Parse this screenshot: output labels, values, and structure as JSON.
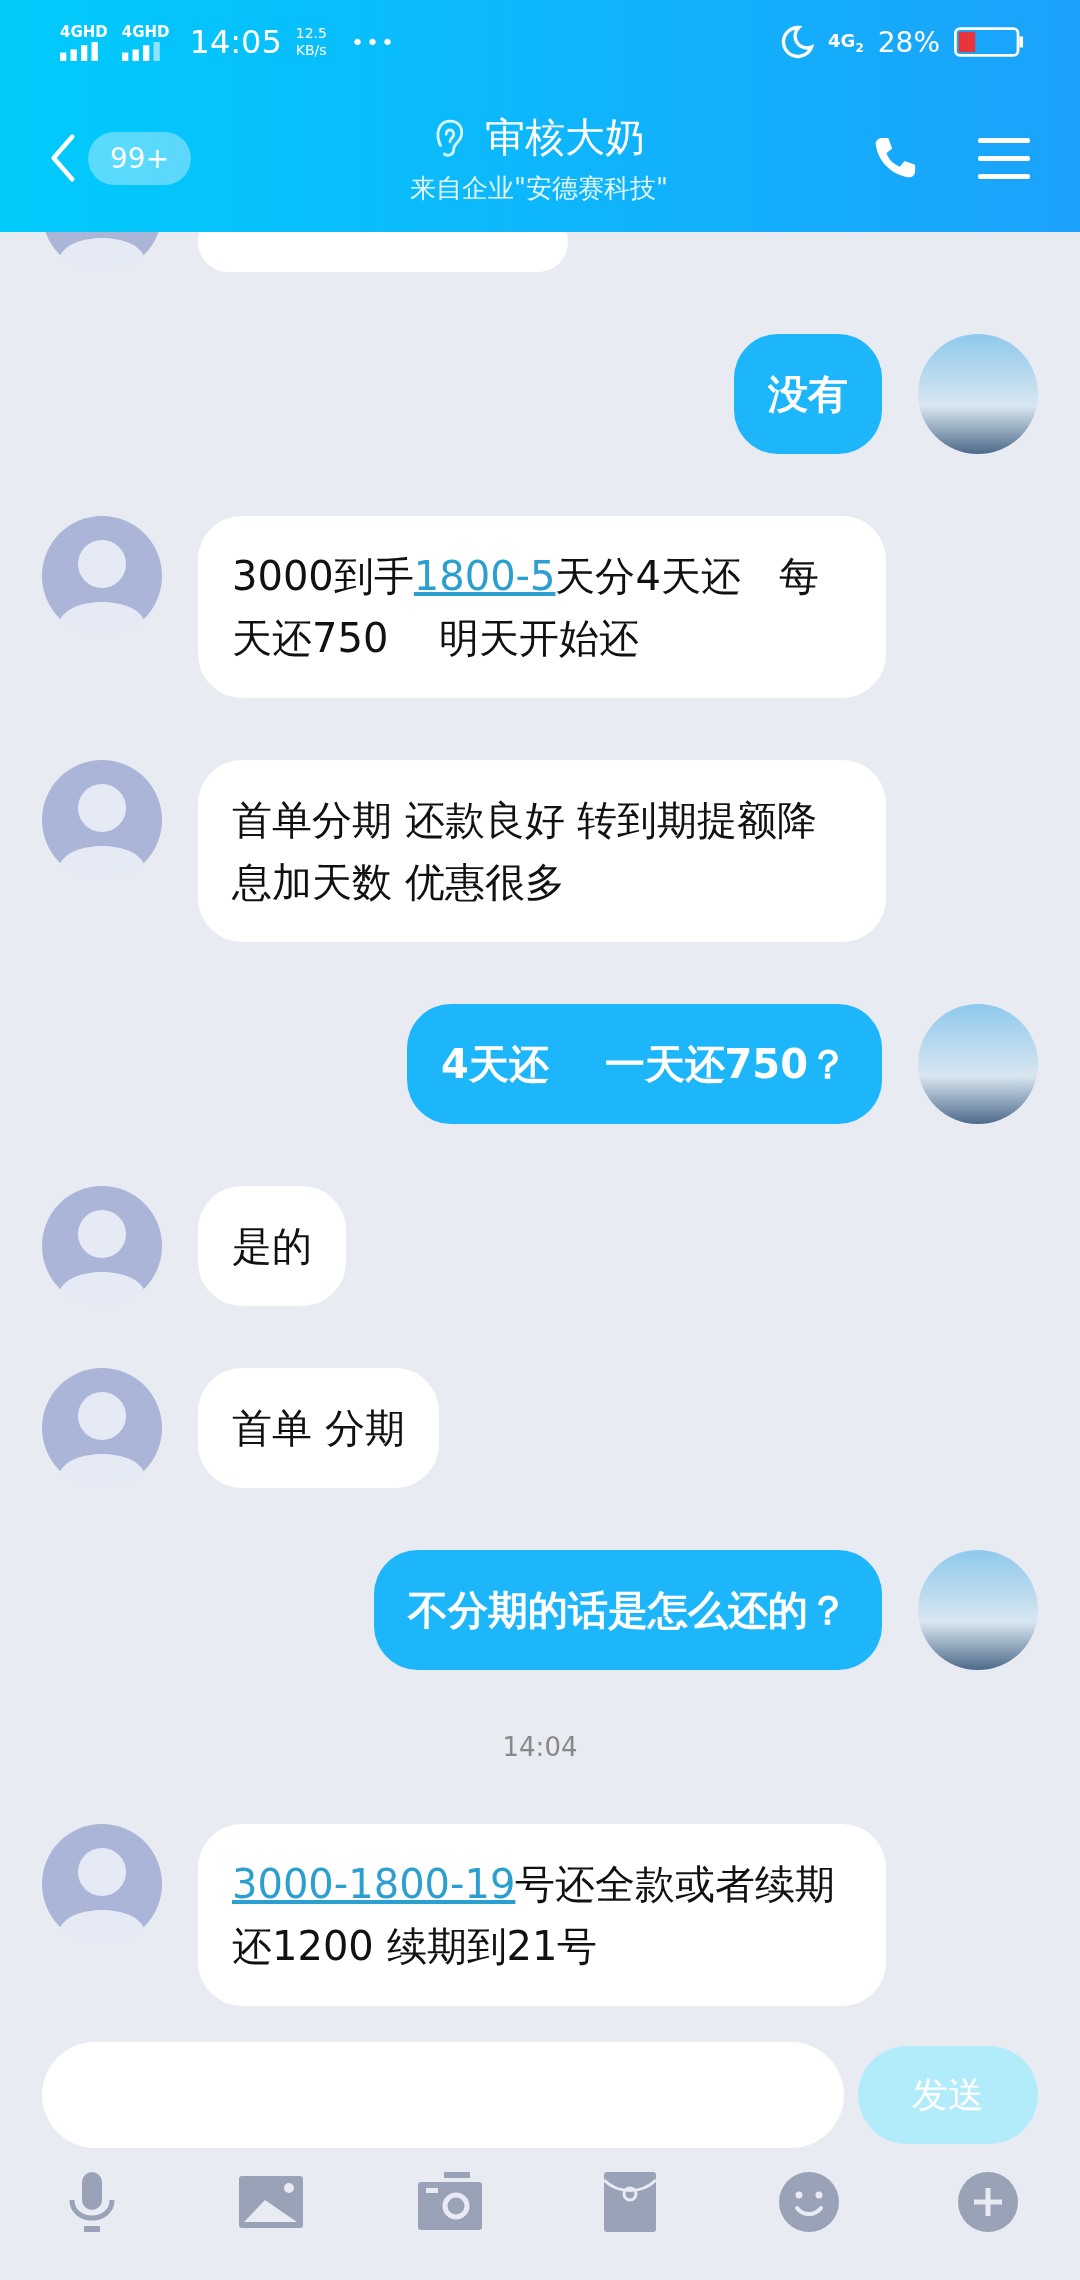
{
  "status_bar": {
    "networks": [
      "4GHD",
      "4GHD"
    ],
    "time": "14:05",
    "speed": "12.5",
    "speed_unit": "KB/s",
    "more": "•••",
    "net": "4G",
    "sim": "2",
    "battery": "28%"
  },
  "header": {
    "badge": "99+",
    "title": "审核大奶",
    "subtitle": "来自企业\"安德赛科技\""
  },
  "messages": [
    {
      "kind": "clipped"
    },
    {
      "kind": "out",
      "parts": [
        {
          "text": "没有",
          "link": false
        }
      ]
    },
    {
      "kind": "in",
      "parts": [
        {
          "text": "3000到手",
          "link": false
        },
        {
          "text": "1800-5",
          "link": true
        },
        {
          "text": "天分4天还   每天还750    明天开始还",
          "link": false
        }
      ]
    },
    {
      "kind": "in",
      "parts": [
        {
          "text": "首单分期 还款良好 转到期提额降息加天数 优惠很多",
          "link": false
        }
      ]
    },
    {
      "kind": "out",
      "parts": [
        {
          "text": "4天还    一天还750？",
          "link": false
        }
      ]
    },
    {
      "kind": "in",
      "parts": [
        {
          "text": "是的",
          "link": false
        }
      ]
    },
    {
      "kind": "in",
      "parts": [
        {
          "text": "首单 分期",
          "link": false
        }
      ]
    },
    {
      "kind": "out",
      "parts": [
        {
          "text": "不分期的话是怎么还的？",
          "link": false
        }
      ]
    },
    {
      "kind": "time",
      "text": "14:04"
    },
    {
      "kind": "in",
      "parts": [
        {
          "text": "3000-1800-19",
          "link": true
        },
        {
          "text": "号还全款或者续期还1200 续期到21号",
          "link": false
        }
      ]
    }
  ],
  "composer": {
    "send": {
      "label": "发送",
      "disabled": true
    }
  },
  "toolbar": [
    {
      "kind": "mic"
    },
    {
      "kind": "image"
    },
    {
      "kind": "camera"
    },
    {
      "kind": "envelope"
    },
    {
      "kind": "smiley"
    },
    {
      "kind": "plus"
    }
  ]
}
